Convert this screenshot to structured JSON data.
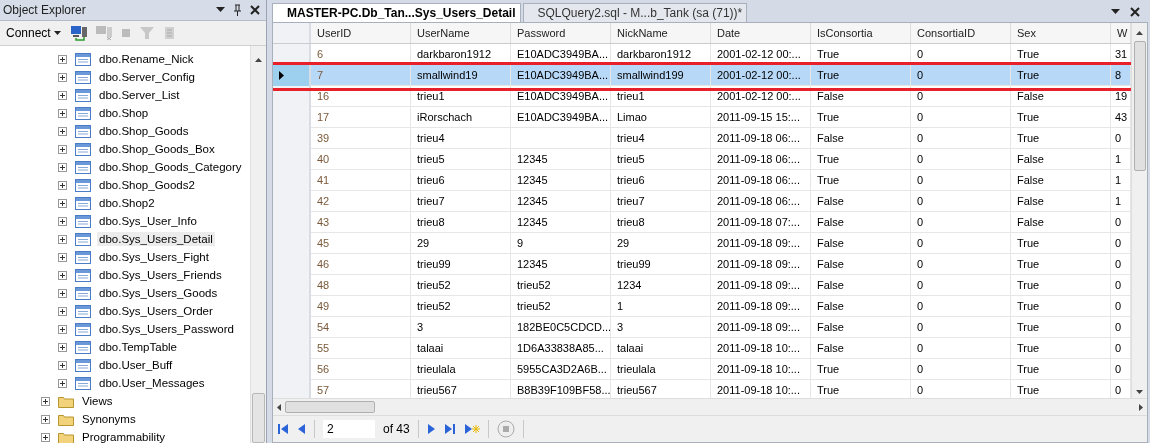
{
  "explorer": {
    "title": "Object Explorer",
    "connect": "Connect",
    "tables": [
      {
        "label": "dbo.Rename_Nick",
        "selected": false
      },
      {
        "label": "dbo.Server_Config",
        "selected": false
      },
      {
        "label": "dbo.Server_List",
        "selected": false
      },
      {
        "label": "dbo.Shop",
        "selected": false
      },
      {
        "label": "dbo.Shop_Goods",
        "selected": false
      },
      {
        "label": "dbo.Shop_Goods_Box",
        "selected": false
      },
      {
        "label": "dbo.Shop_Goods_Category",
        "selected": false
      },
      {
        "label": "dbo.Shop_Goods2",
        "selected": false
      },
      {
        "label": "dbo.Shop2",
        "selected": false
      },
      {
        "label": "dbo.Sys_User_Info",
        "selected": false
      },
      {
        "label": "dbo.Sys_Users_Detail",
        "selected": true
      },
      {
        "label": "dbo.Sys_Users_Fight",
        "selected": false
      },
      {
        "label": "dbo.Sys_Users_Friends",
        "selected": false
      },
      {
        "label": "dbo.Sys_Users_Goods",
        "selected": false
      },
      {
        "label": "dbo.Sys_Users_Order",
        "selected": false
      },
      {
        "label": "dbo.Sys_Users_Password",
        "selected": false
      },
      {
        "label": "dbo.TempTable",
        "selected": false
      },
      {
        "label": "dbo.User_Buff",
        "selected": false
      },
      {
        "label": "dbo.User_Messages",
        "selected": false
      }
    ],
    "folders": [
      {
        "label": "Views"
      },
      {
        "label": "Synonyms"
      },
      {
        "label": "Programmability"
      }
    ]
  },
  "tabs": [
    {
      "label": "MASTER-PC.Db_Tan...Sys_Users_Detail",
      "selected": true
    },
    {
      "label": "SQLQuery2.sql - M...b_Tank (sa (71))*",
      "selected": false
    }
  ],
  "grid": {
    "columns": [
      "UserID",
      "UserName",
      "Password",
      "NickName",
      "Date",
      "IsConsortia",
      "ConsortiaID",
      "Sex",
      "W"
    ],
    "rows": [
      {
        "selected": false,
        "cells": [
          "6",
          "darkbaron1912",
          "E10ADC3949BA...",
          "darkbaron1912",
          "2001-02-12 00:...",
          "True",
          "0",
          "True",
          "31"
        ]
      },
      {
        "selected": true,
        "cells": [
          "7",
          "smallwind19",
          "E10ADC3949BA...",
          "smallwind199",
          "2001-02-12 00:...",
          "True",
          "0",
          "True",
          "8"
        ]
      },
      {
        "selected": false,
        "cells": [
          "16",
          "trieu1",
          "E10ADC3949BA...",
          "trieu1",
          "2001-02-12 00:...",
          "False",
          "0",
          "False",
          "19"
        ]
      },
      {
        "selected": false,
        "cells": [
          "17",
          "iRorschach",
          "E10ADC3949BA...",
          "Limao",
          "2011-09-15 15:...",
          "True",
          "0",
          "True",
          "43"
        ]
      },
      {
        "selected": false,
        "cells": [
          "39",
          "trieu4",
          null,
          "trieu4",
          "2011-09-18 06:...",
          "False",
          "0",
          "True",
          "0"
        ]
      },
      {
        "selected": false,
        "cells": [
          "40",
          "trieu5",
          "12345",
          "trieu5",
          "2011-09-18 06:...",
          "True",
          "0",
          "False",
          "1"
        ]
      },
      {
        "selected": false,
        "cells": [
          "41",
          "trieu6",
          "12345",
          "trieu6",
          "2011-09-18 06:...",
          "True",
          "0",
          "False",
          "1"
        ]
      },
      {
        "selected": false,
        "cells": [
          "42",
          "trieu7",
          "12345",
          "trieu7",
          "2011-09-18 06:...",
          "False",
          "0",
          "False",
          "1"
        ]
      },
      {
        "selected": false,
        "cells": [
          "43",
          "trieu8",
          "12345",
          "trieu8",
          "2011-09-18 07:...",
          "False",
          "0",
          "False",
          "0"
        ]
      },
      {
        "selected": false,
        "cells": [
          "45",
          "29",
          "9",
          "29",
          "2011-09-18 09:...",
          "False",
          "0",
          "True",
          "0"
        ]
      },
      {
        "selected": false,
        "cells": [
          "46",
          "trieu99",
          "12345",
          "trieu99",
          "2011-09-18 09:...",
          "False",
          "0",
          "True",
          "0"
        ]
      },
      {
        "selected": false,
        "cells": [
          "48",
          "trieu52",
          "trieu52",
          "1234",
          "2011-09-18 09:...",
          "False",
          "0",
          "True",
          "0"
        ]
      },
      {
        "selected": false,
        "cells": [
          "49",
          "trieu52",
          "trieu52",
          "1",
          "2011-09-18 09:...",
          "False",
          "0",
          "True",
          "0"
        ]
      },
      {
        "selected": false,
        "cells": [
          "54",
          "3",
          "182BE0C5CDCD...",
          "3",
          "2011-09-18 09:...",
          "False",
          "0",
          "True",
          "0"
        ]
      },
      {
        "selected": false,
        "cells": [
          "55",
          "talaai",
          "1D6A33838A85...",
          "talaai",
          "2011-09-18 10:...",
          "False",
          "0",
          "True",
          "0"
        ]
      },
      {
        "selected": false,
        "cells": [
          "56",
          "trieulala",
          "5955CA3D2A6B...",
          "trieulala",
          "2011-09-18 10:...",
          "True",
          "0",
          "True",
          "0"
        ]
      },
      {
        "selected": false,
        "cells": [
          "57",
          "trieu567",
          "B8B39F109BF58...",
          "trieu567",
          "2011-09-18 10:...",
          "True",
          "0",
          "True",
          "0"
        ]
      }
    ]
  },
  "navigator": {
    "page": "2",
    "of": "of 43"
  }
}
